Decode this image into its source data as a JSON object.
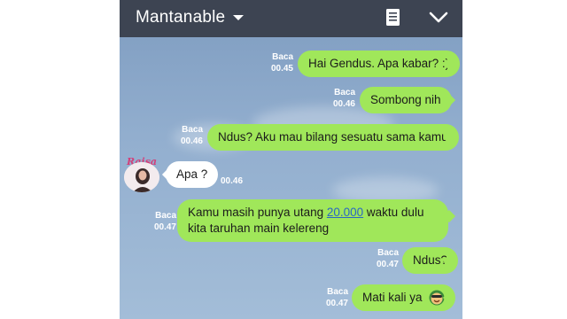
{
  "header": {
    "title": "Mantanable",
    "note_icon": "note-icon",
    "collapse_icon": "chevron-down-icon"
  },
  "contact": {
    "avatar_label": "Raisa"
  },
  "messages": [
    {
      "text": "Hai Gendus. Apa kabar? :)",
      "status": "Baca",
      "time": "00.45"
    },
    {
      "text": "Sombong nih",
      "status": "Baca",
      "time": "00.46"
    },
    {
      "text": "Ndus? Aku mau bilang sesuatu sama kamu",
      "status": "Baca",
      "time": "00.46"
    },
    {
      "text": "Apa ?",
      "time": "00.46"
    },
    {
      "text_before": "Kamu masih punya utang ",
      "link": "20.000",
      "text_after": " waktu dulu kita taruhan main kelereng",
      "status": "Baca",
      "time": "00.47"
    },
    {
      "text": "Ndus?",
      "status": "Baca",
      "time": "00.47"
    },
    {
      "text": "Mati kali ya",
      "emoji": "smiley-face-icon",
      "status": "Baca",
      "time": "00.47"
    }
  ],
  "colors": {
    "header": "#3d4452",
    "sent_bubble": "#a0e75a",
    "received_bubble": "#ffffff",
    "background": "#93afcf",
    "link": "#2a67c4"
  }
}
